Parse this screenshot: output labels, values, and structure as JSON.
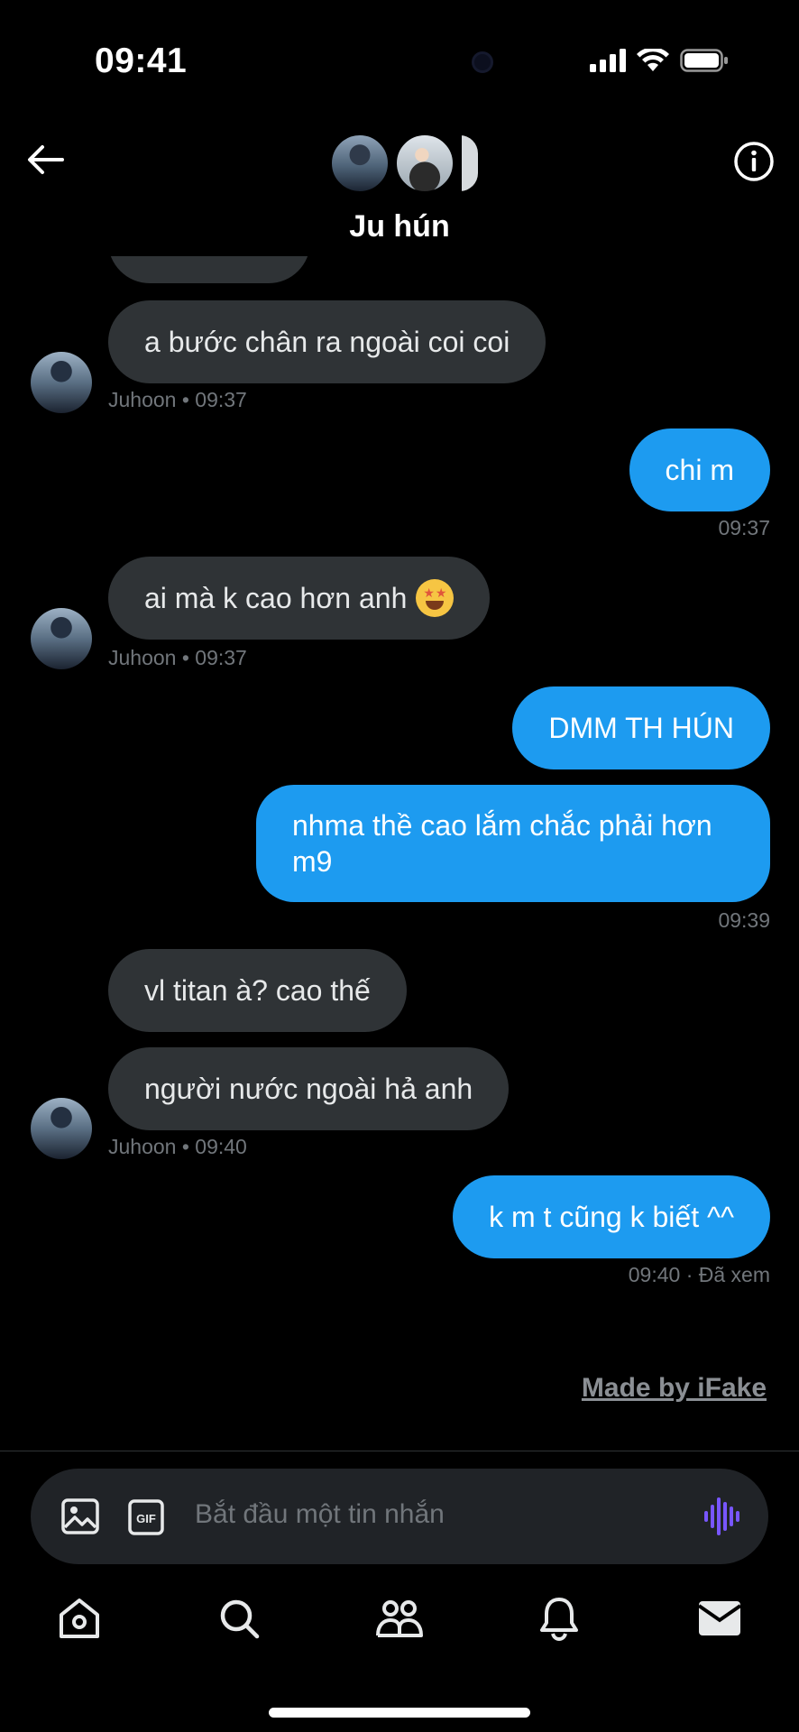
{
  "status_bar": {
    "time": "09:41"
  },
  "header": {
    "title": "Ju hún"
  },
  "messages": [
    {
      "text": "a bước chân ra ngoài coi coi",
      "meta": "Juhoon • 09:37"
    },
    {
      "text": "chi m",
      "meta": "09:37"
    },
    {
      "text": "ai mà k cao hơn anh",
      "meta": "Juhoon • 09:37"
    },
    {
      "text": "DMM TH HÚN"
    },
    {
      "text": "nhma thề cao lắm chắc phải hơn m9",
      "meta": "09:39"
    },
    {
      "text": "vl titan à? cao thế"
    },
    {
      "text": "người nước ngoài hả anh",
      "meta": "Juhoon • 09:40"
    },
    {
      "text": "k m t cũng k biết ^^",
      "meta": "09:40 · Đã xem"
    }
  ],
  "watermark": "Made by iFake",
  "composer": {
    "placeholder": "Bắt đầu một tin nhắn",
    "gif_label": "GIF"
  },
  "colors": {
    "outgoing": "#1d9bf0",
    "incoming": "#2f3336",
    "voice": "#7856ff"
  }
}
